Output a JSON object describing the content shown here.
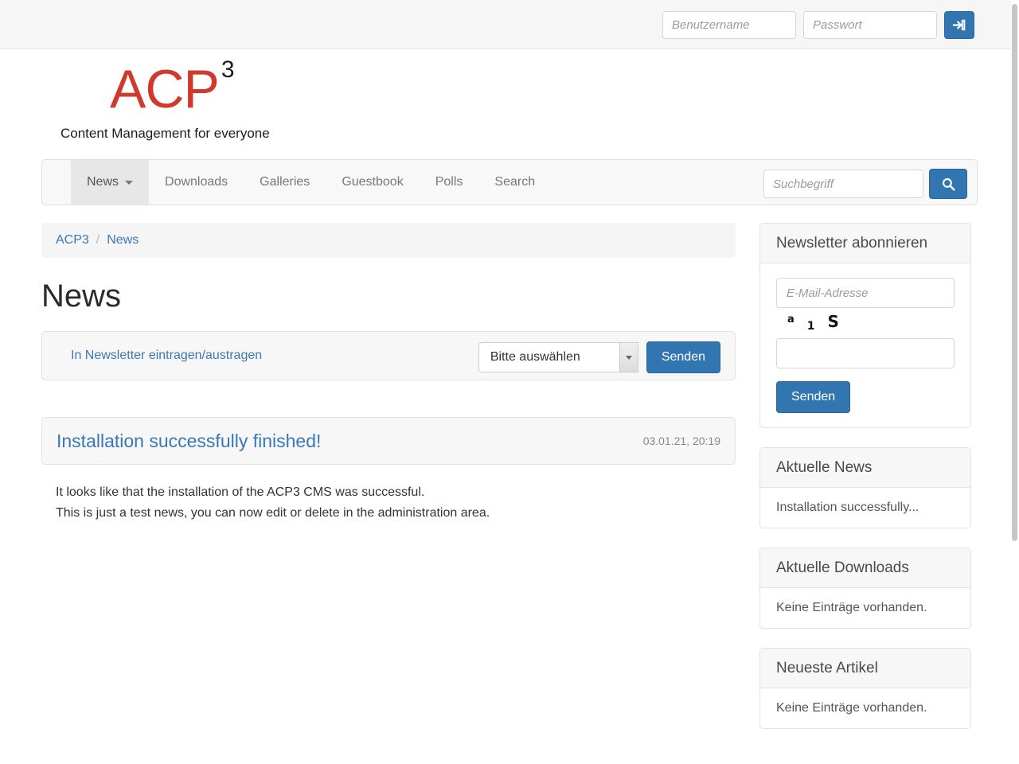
{
  "topbar": {
    "username_placeholder": "Benutzername",
    "password_placeholder": "Passwort",
    "login_button_icon": "login-arrow-icon"
  },
  "brand": {
    "logo_text": "ACP",
    "logo_superscript": "3",
    "tagline": "Content Management for everyone",
    "logo_color": "#d0392b"
  },
  "nav": {
    "items": [
      {
        "label": "News",
        "active": true,
        "has_caret": true
      },
      {
        "label": "Downloads",
        "active": false,
        "has_caret": false
      },
      {
        "label": "Galleries",
        "active": false,
        "has_caret": false
      },
      {
        "label": "Guestbook",
        "active": false,
        "has_caret": false
      },
      {
        "label": "Polls",
        "active": false,
        "has_caret": false
      },
      {
        "label": "Search",
        "active": false,
        "has_caret": false
      }
    ],
    "search_placeholder": "Suchbegriff",
    "search_button_icon": "search-icon"
  },
  "breadcrumb": {
    "items": [
      "ACP3",
      "News"
    ],
    "separator": "/"
  },
  "main": {
    "page_title": "News",
    "newsletter_row": {
      "link_label": "In Newsletter eintragen/austragen",
      "select_value": "Bitte auswählen",
      "submit_label": "Senden"
    },
    "article": {
      "title": "Installation successfully finished!",
      "date": "03.01.21, 20:19",
      "body_line1": "It looks like that the installation of the ACP3 CMS was successful.",
      "body_line2": "This is just a test news, you can now edit or delete in the administration area."
    }
  },
  "sidebar": {
    "newsletter_widget": {
      "title": "Newsletter abonnieren",
      "email_placeholder": "E-Mail-Adresse",
      "captcha_chars": [
        "a",
        "1",
        "S"
      ],
      "captcha_value": "",
      "submit_label": "Senden"
    },
    "widgets": [
      {
        "title": "Aktuelle News",
        "entry": "Installation successfully..."
      },
      {
        "title": "Aktuelle Downloads",
        "entry": "Keine Einträge vorhanden."
      },
      {
        "title": "Neueste Artikel",
        "entry": "Keine Einträge vorhanden."
      }
    ]
  },
  "theme": {
    "primary_blue": "#3276b1",
    "link_blue": "#3a78b5",
    "panel_gray": "#f7f7f7"
  }
}
